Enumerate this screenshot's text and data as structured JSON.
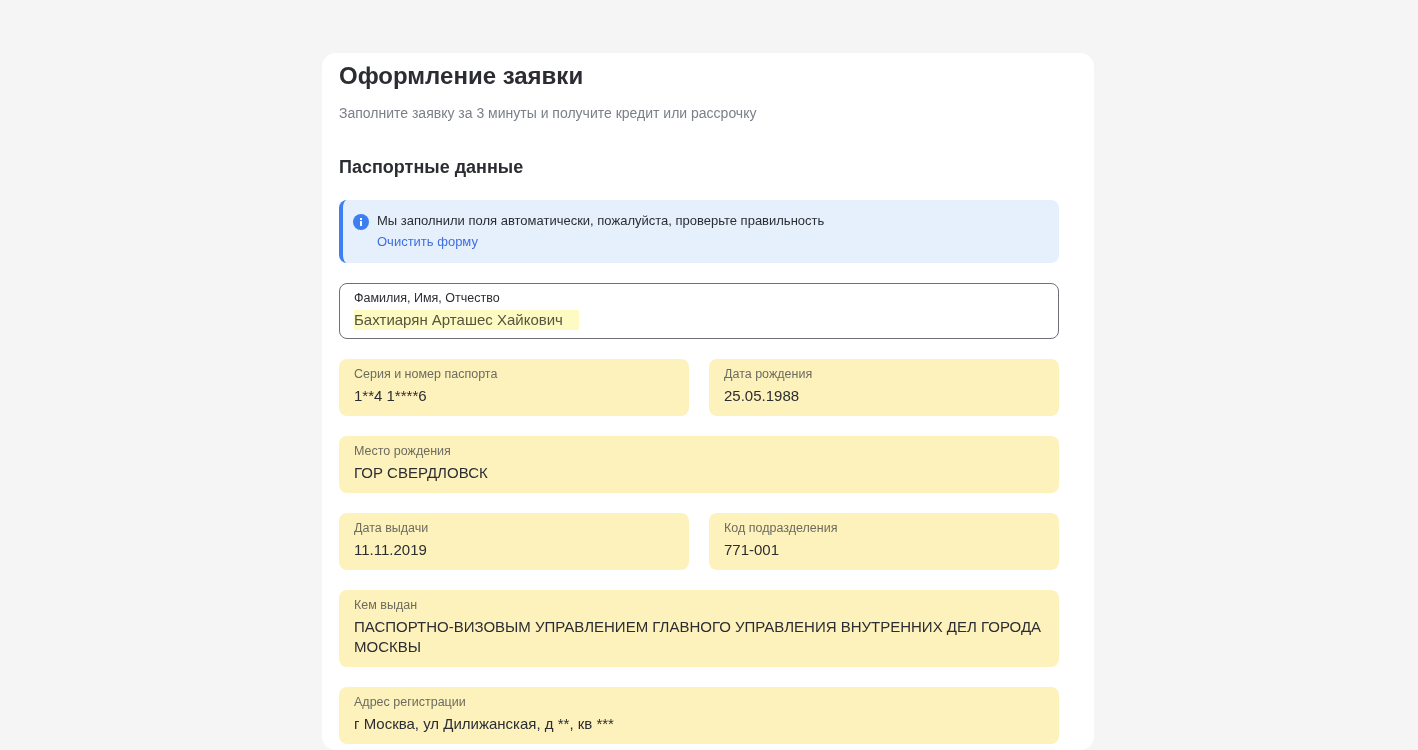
{
  "title": "Оформление заявки",
  "subtitle": "Заполните заявку за 3 минуты и получите кредит или рассрочку",
  "section": "Паспортные данные",
  "notice": {
    "text": "Мы заполнили поля автоматически, пожалуйста, проверьте правильность",
    "link": "Очистить форму"
  },
  "rows": [
    [
      {
        "label": "Фамилия, Имя, Отчество",
        "value": "Бахтиарян Арташес Хайкович",
        "kind": "outlined",
        "highlighted": true
      }
    ],
    [
      {
        "label": "Серия и номер паспорта",
        "value": "1**4 1****6",
        "kind": "filled",
        "highlighted": false
      },
      {
        "label": "Дата рождения",
        "value": "25.05.1988",
        "kind": "filled",
        "highlighted": false
      }
    ],
    [
      {
        "label": "Место рождения",
        "value": "ГОР СВЕРДЛОВСК",
        "kind": "filled",
        "highlighted": false
      }
    ],
    [
      {
        "label": "Дата выдачи",
        "value": "11.11.2019",
        "kind": "filled",
        "highlighted": false
      },
      {
        "label": "Код подразделения",
        "value": "771-001",
        "kind": "filled",
        "highlighted": false
      }
    ],
    [
      {
        "label": "Кем выдан",
        "value": "ПАСПОРТНО-ВИЗОВЫМ УПРАВЛЕНИЕМ ГЛАВНОГО УПРАВЛЕНИЯ ВНУТРЕННИХ ДЕЛ ГОРОДА МОСКВЫ",
        "kind": "filled",
        "highlighted": false
      }
    ],
    [
      {
        "label": "Адрес регистрации",
        "value": "г Москва, ул Дилижанская, д **, кв ***",
        "kind": "filled",
        "highlighted": false
      }
    ]
  ]
}
